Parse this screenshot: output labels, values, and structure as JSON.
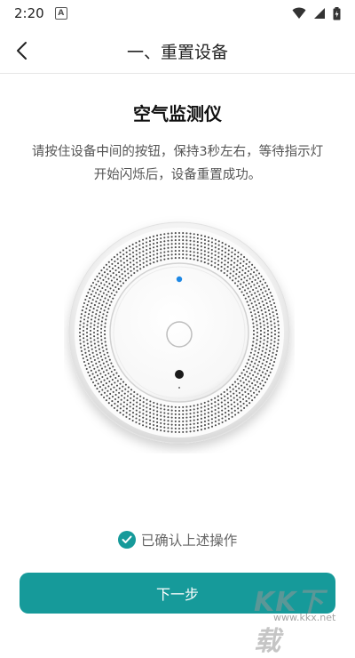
{
  "status_bar": {
    "time": "2:20",
    "notification_icon_letter": "A",
    "icons": [
      "wifi-icon",
      "signal-icon",
      "battery-icon"
    ]
  },
  "header": {
    "title": "一、重置设备",
    "back_icon": "chevron-left-icon"
  },
  "main": {
    "device_name": "空气监测仪",
    "instruction_line1": "请按住设备中间的按钮，保持3秒左右，等待指示灯",
    "instruction_line2": "开始闪烁后，设备重置成功。",
    "device_image": "air-monitor-device"
  },
  "footer": {
    "confirm_label": "已确认上述操作",
    "confirm_checked": true,
    "next_label": "下一步"
  },
  "watermark": {
    "logo_text": "KK下载",
    "url": "www.kkx.net"
  },
  "colors": {
    "accent": "#169a9a",
    "indicator_blue": "#1e88e5"
  }
}
